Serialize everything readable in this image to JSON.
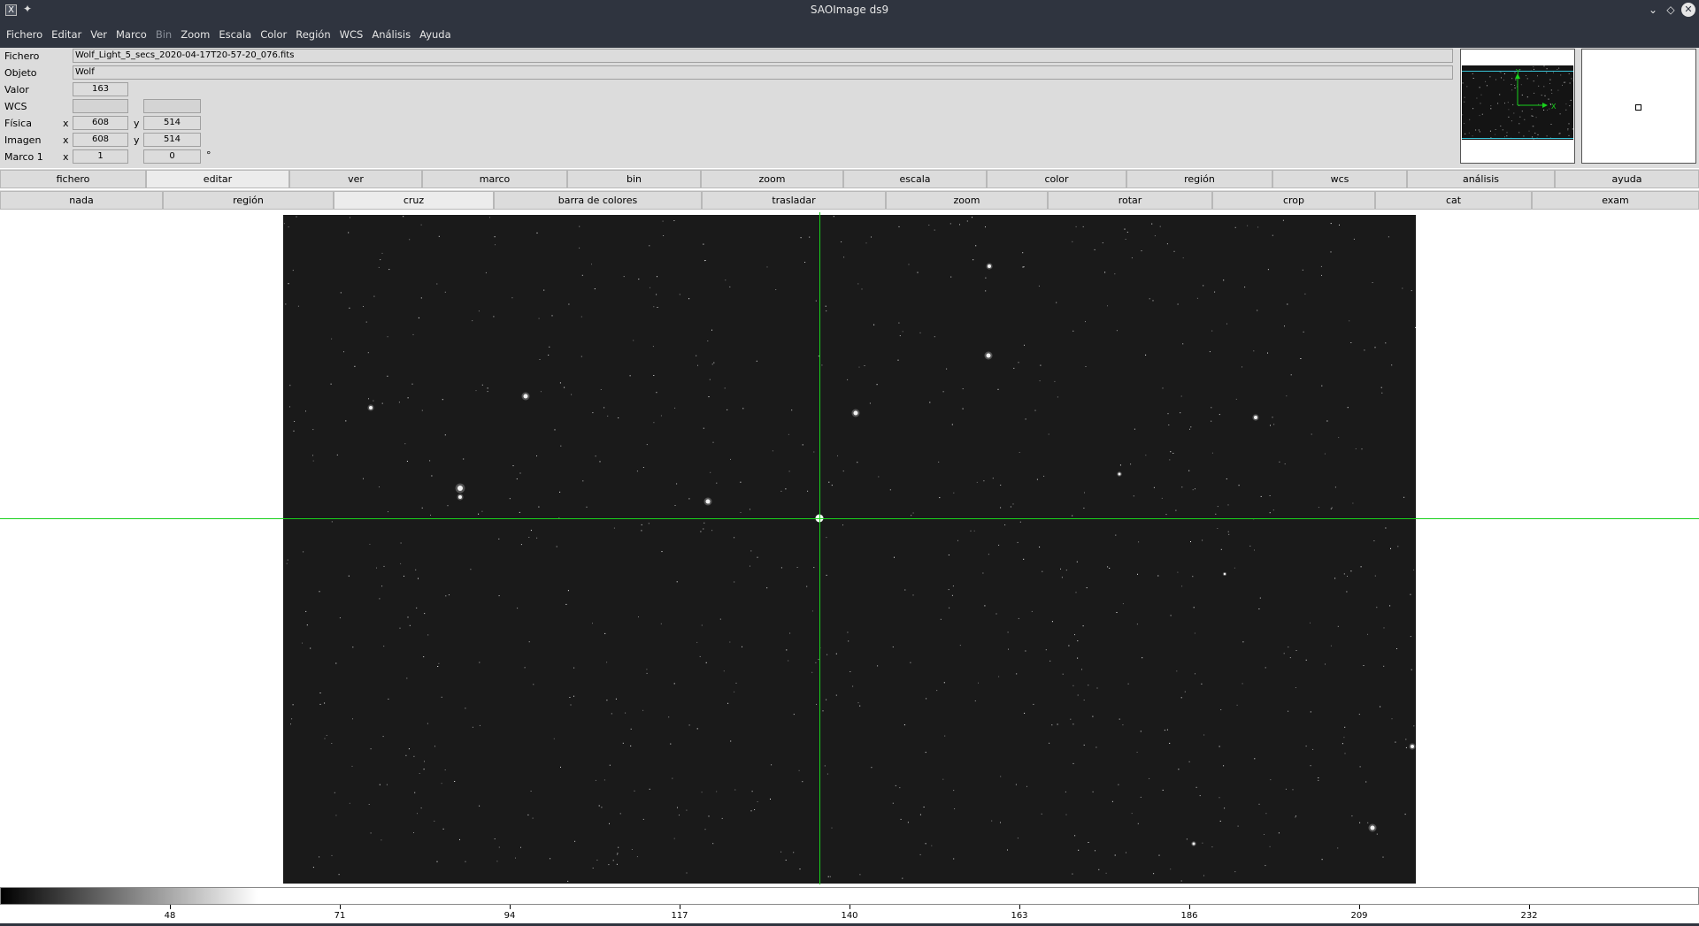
{
  "window": {
    "title": "SAOImage ds9",
    "app_icon": "x-window-icon",
    "pin_icon": "pin-icon",
    "controls": [
      "minimize-icon",
      "maximize-icon",
      "close-icon"
    ]
  },
  "menu": [
    "Fichero",
    "Editar",
    "Ver",
    "Marco",
    "Bin",
    "Zoom",
    "Escala",
    "Color",
    "Región",
    "WCS",
    "Análisis",
    "Ayuda"
  ],
  "menu_disabled": "Bin",
  "info": {
    "fichero_label": "Fichero",
    "fichero_value": "Wolf_Light_5_secs_2020-04-17T20-57-20_076.fits",
    "objeto_label": "Objeto",
    "objeto_value": "Wolf",
    "valor_label": "Valor",
    "valor_value": "163",
    "wcs_label": "WCS",
    "fisica_label": "Física",
    "fisica_x_label": "x",
    "fisica_x": "608",
    "fisica_y_label": "y",
    "fisica_y": "514",
    "imagen_label": "Imagen",
    "imagen_x_label": "x",
    "imagen_x": "608",
    "imagen_y_label": "y",
    "imagen_y": "514",
    "marco_label": "Marco 1",
    "marco_x_label": "x",
    "marco_x": "1",
    "marco_angle": "0",
    "marco_degree": "°"
  },
  "panner": {
    "axis_x": "X",
    "axis_y": "Y"
  },
  "buttonbar1": [
    "fichero",
    "editar",
    "ver",
    "marco",
    "bin",
    "zoom",
    "escala",
    "color",
    "región",
    "wcs",
    "análisis",
    "ayuda"
  ],
  "buttonbar1_active": "editar",
  "buttonbar2": [
    "nada",
    "región",
    "cruz",
    "barra de colores",
    "trasladar",
    "zoom",
    "rotar",
    "crop",
    "cat",
    "exam"
  ],
  "buttonbar2_active": "cruz",
  "colorbar": {
    "colormap": "grey",
    "ticks": [
      "48",
      "71",
      "94",
      "117",
      "140",
      "163",
      "186",
      "209",
      "232"
    ]
  },
  "colors": {
    "titlebar": "#2f343f",
    "crosshair": "#19d11c",
    "panner_frame": "#39c3d6"
  }
}
